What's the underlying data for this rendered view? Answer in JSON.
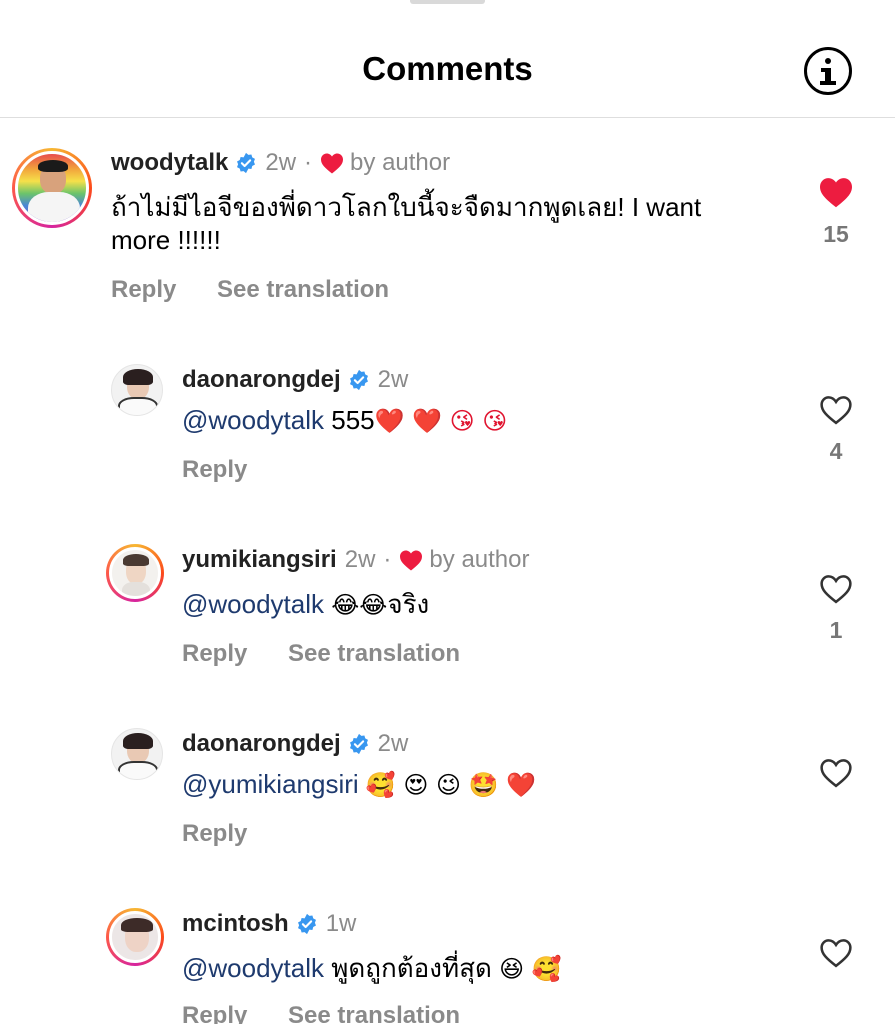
{
  "header": {
    "title": "Comments",
    "info_icon": "info-icon"
  },
  "colors": {
    "accent_like": "#ed1c40",
    "mention": "#1e3a6e",
    "verified": "#3897f0",
    "muted": "#8a8a8a"
  },
  "comments": [
    {
      "username": "woodytalk",
      "time": "2w",
      "separator": "·",
      "by_author": "by author",
      "text_line1": "ถ้าไม่มีไอจีของพี่ดาวโลกใบนี้จะจืดมากพูดเลย! I want",
      "text_line2": "more !!!!!!",
      "reply": "Reply",
      "translate": "See translation",
      "likes": "15",
      "liked": true
    },
    {
      "username": "daonarongdej",
      "time": "2w",
      "mention": "@woodytalk",
      "text": " 555",
      "emojis": "❤️ ❤️ 😘 😘",
      "reply": "Reply",
      "likes": "4",
      "liked": false
    },
    {
      "username": "yumikiangsiri",
      "time": "2w",
      "separator": "·",
      "by_author": "by author",
      "mention": "@woodytalk",
      "emojis": "😂😂",
      "text": "จริง",
      "reply": "Reply",
      "translate": "See translation",
      "likes": "1",
      "liked": false
    },
    {
      "username": "daonarongdej",
      "time": "2w",
      "mention": "@yumikiangsiri",
      "emojis": "🥰 😍 😉 🤩 ❤️",
      "reply": "Reply",
      "liked": false
    },
    {
      "username": "mcintosh",
      "time": "1w",
      "mention": "@woodytalk",
      "text": " พูดถูกต้องที่สุด ",
      "emojis": "😆 🥰",
      "reply": "Reply",
      "translate": "See translation",
      "liked": false
    }
  ]
}
